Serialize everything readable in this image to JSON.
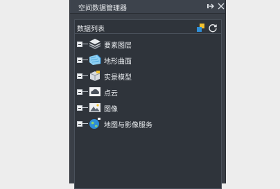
{
  "window": {
    "title": "空间数据管理器"
  },
  "list": {
    "header": "数据列表",
    "items": [
      {
        "label": "要素图层",
        "icon": "layers-icon"
      },
      {
        "label": "地形曲面",
        "icon": "terrain-icon"
      },
      {
        "label": "实景模型",
        "icon": "model-icon"
      },
      {
        "label": "点云",
        "icon": "point-cloud-icon"
      },
      {
        "label": "图像",
        "icon": "image-icon"
      },
      {
        "label": "地图与影像服务",
        "icon": "globe-icon"
      }
    ]
  },
  "colors": {
    "panel_bg": "#3a3f47",
    "inner_bg": "#2f343b",
    "text": "#e6e8eb",
    "accent_blue": "#2f8fd8",
    "accent_yellow": "#f2c230"
  }
}
